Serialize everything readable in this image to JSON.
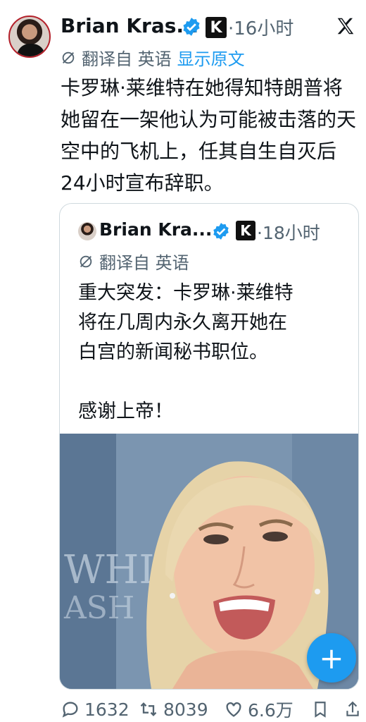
{
  "tweet": {
    "author_name": "Brian Kras...",
    "time": "·16小时",
    "translate_prefix": "翻译自 英语",
    "show_original": "显示原文",
    "text": "卡罗琳·莱维特在她得知特朗普将她留在一架他认为可能被击落的天空中的飞机上，任其自生自灭后24小时宣布辞职。"
  },
  "quote": {
    "author_name": "Brian Kra...",
    "time": "·18小时",
    "translate_prefix": "翻译自 英语",
    "text": "重大突发：卡罗琳·莱维特\n将在几周内永久离开她在\n白宫的新闻秘书职位。\n\n感谢上帝！",
    "photo_bg_text": "WHI\nASH"
  },
  "actions": {
    "replies": "1632",
    "retweets": "8039",
    "likes": "6.6万"
  },
  "badge_letter": "K",
  "fab_label": "+",
  "colors": {
    "accent": "#1d9bf0",
    "muted": "#536471",
    "text": "#0f1419"
  }
}
